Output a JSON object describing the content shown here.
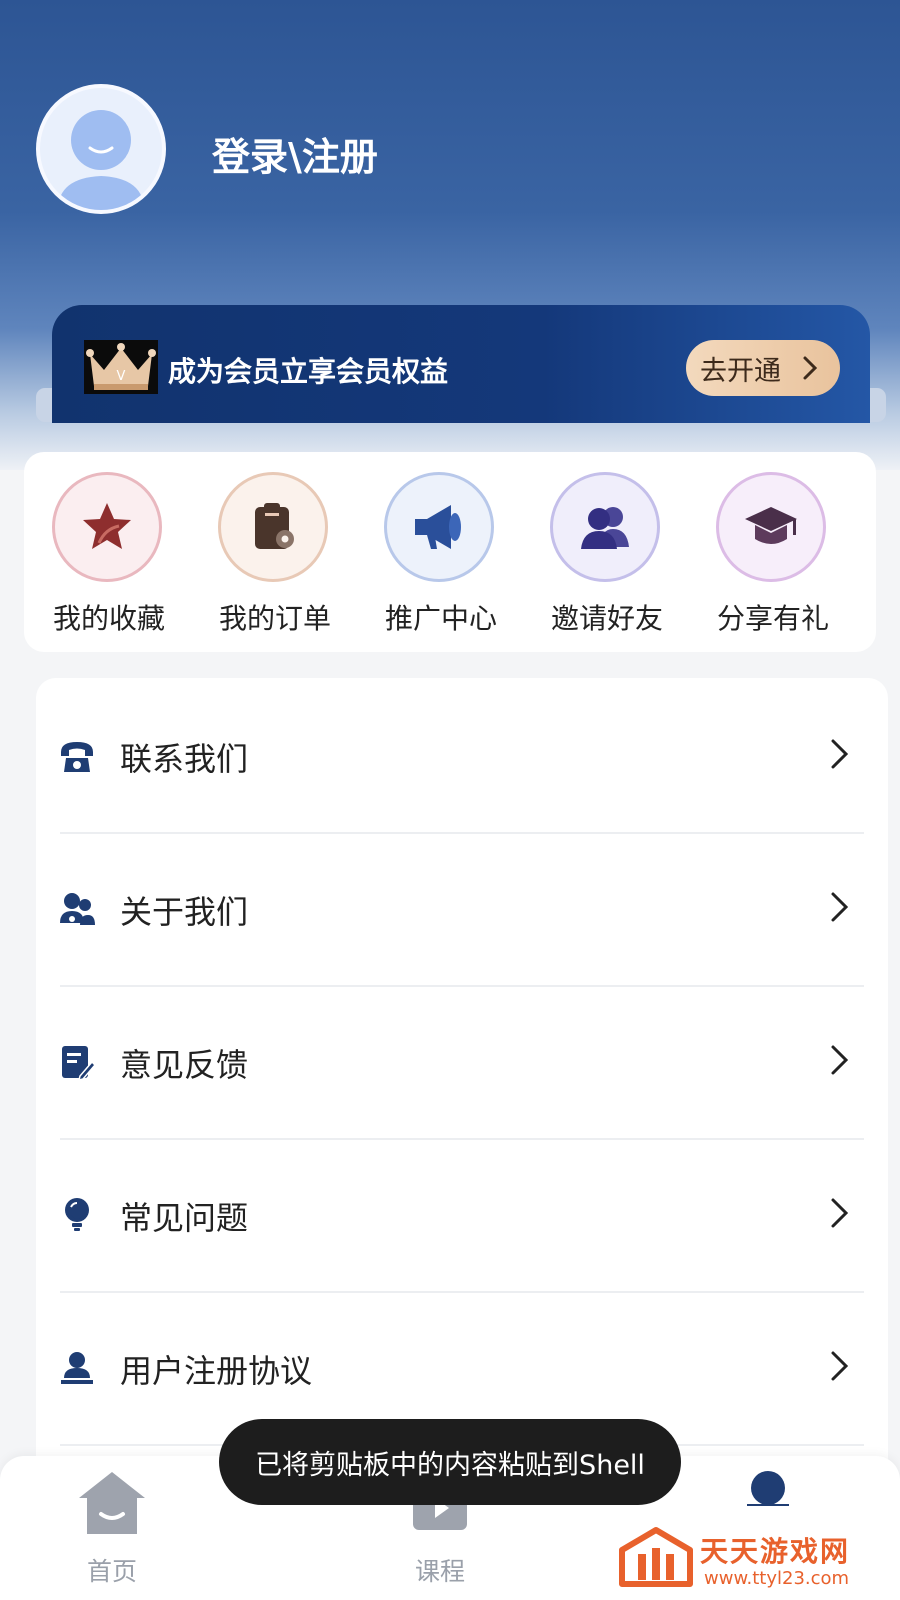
{
  "profile": {
    "login_label": "登录\\注册"
  },
  "vip": {
    "crown_letter": "V",
    "text": "成为会员立享会员权益",
    "button_label": "去开通"
  },
  "quick_actions": [
    {
      "label": "我的收藏",
      "icon": "star-icon",
      "ring": "#e9b8bf",
      "fill": "#fbeef0"
    },
    {
      "label": "我的订单",
      "icon": "clipboard-order-icon",
      "ring": "#e8c9b6",
      "fill": "#fbf2ec"
    },
    {
      "label": "推广中心",
      "icon": "megaphone-icon",
      "ring": "#b8c8ea",
      "fill": "#edf2fb"
    },
    {
      "label": "邀请好友",
      "icon": "users-icon",
      "ring": "#c4bfea",
      "fill": "#f0eefb"
    },
    {
      "label": "分享有礼",
      "icon": "graduation-cap-icon",
      "ring": "#dcbce6",
      "fill": "#f7eefa"
    }
  ],
  "menu_items": [
    {
      "label": "联系我们",
      "icon": "phone-icon"
    },
    {
      "label": "关于我们",
      "icon": "team-icon"
    },
    {
      "label": "意见反馈",
      "icon": "feedback-icon"
    },
    {
      "label": "常见问题",
      "icon": "lightbulb-icon"
    },
    {
      "label": "用户注册协议",
      "icon": "user-agreement-icon"
    }
  ],
  "tabs": [
    {
      "label": "首页",
      "icon": "home-icon"
    },
    {
      "label": "课程",
      "icon": "course-play-icon"
    },
    {
      "label": "",
      "icon": "profile-icon"
    }
  ],
  "toast": {
    "text": "已将剪贴板中的内容粘贴到Shell"
  },
  "watermark": {
    "title": "天天游戏网",
    "url": "www.ttyl23.com"
  },
  "colors": {
    "accent_navy": "#1f3d73",
    "header_blue": "#2d5594",
    "vip_gold": "#e9c39d"
  }
}
